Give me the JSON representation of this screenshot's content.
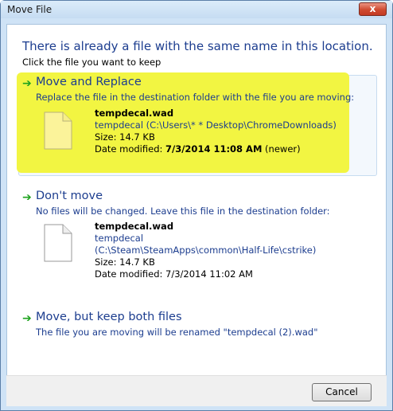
{
  "window": {
    "title": "Move File",
    "close_glyph": "x"
  },
  "heading": "There is already a file with the same name in this location.",
  "subheading": "Click the file you want to keep",
  "options": {
    "replace": {
      "title": "Move and Replace",
      "description": "Replace the file in the destination folder with the file you are moving:",
      "file": {
        "name": "tempdecal.wad",
        "path": "tempdecal (C:\\Users\\*        * Desktop\\ChromeDownloads)",
        "size": "Size: 14.7 KB",
        "date_label": "Date modified: ",
        "date_value": "7/3/2014 11:08 AM",
        "date_note": " (newer)"
      }
    },
    "dont_move": {
      "title": "Don't move",
      "description": "No files will be changed. Leave this file in the destination folder:",
      "file": {
        "name": "tempdecal.wad",
        "path_line1": "tempdecal",
        "path_line2": "(C:\\Steam\\SteamApps\\common\\Half-Life\\cstrike)",
        "size": "Size: 14.7 KB",
        "date": "Date modified: 7/3/2014 11:02 AM"
      }
    },
    "keep_both": {
      "title": "Move, but keep both files",
      "description": "The file you are moving will be renamed \"tempdecal (2).wad\""
    }
  },
  "cancel_label": "Cancel",
  "colors": {
    "link_blue": "#1c3d8f",
    "arrow_green": "#1ea21e",
    "highlight": "#f2f542"
  }
}
